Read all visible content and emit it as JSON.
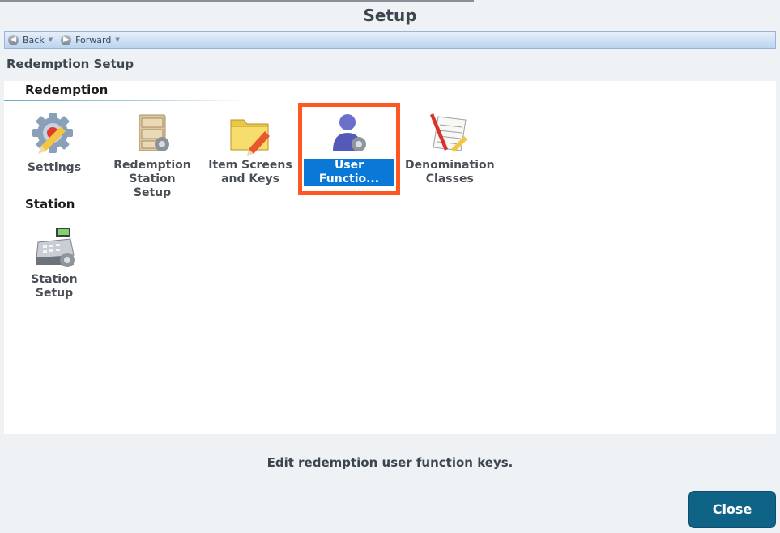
{
  "window": {
    "title": "Setup"
  },
  "nav": {
    "back_label": "Back",
    "forward_label": "Forward"
  },
  "breadcrumb": "Redemption Setup",
  "sections": [
    {
      "title": "Redemption",
      "items": [
        {
          "label": "Settings",
          "icon": "settings-gear-icon"
        },
        {
          "label": "Redemption Station Setup",
          "icon": "cabinet-gear-icon"
        },
        {
          "label": "Item Screens and Keys",
          "icon": "folder-pencil-icon"
        },
        {
          "label": "User Functio...",
          "icon": "user-gear-icon",
          "selected": true
        },
        {
          "label": "Denomination Classes",
          "icon": "paper-pencil-icon"
        }
      ]
    },
    {
      "title": "Station",
      "items": [
        {
          "label": "Station Setup",
          "icon": "cash-register-gear-icon"
        }
      ]
    }
  ],
  "status_text": "Edit redemption user function keys.",
  "close_label": "Close",
  "colors": {
    "accent": "#0e6387",
    "selection": "#0a78d7",
    "highlight": "#ff5722"
  }
}
